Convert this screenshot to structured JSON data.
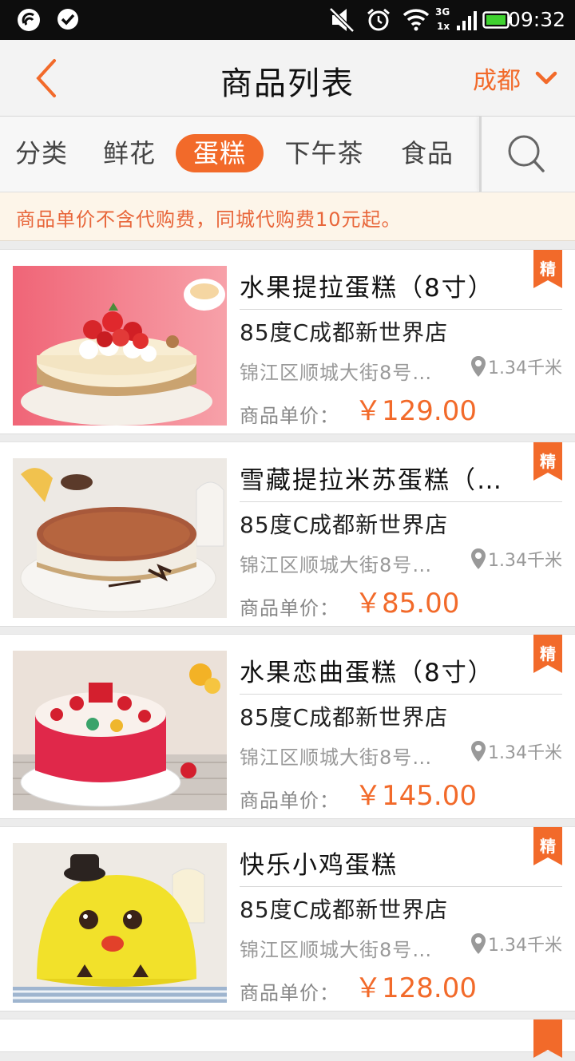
{
  "status_bar": {
    "time": "09:32",
    "network_label": "3G",
    "signal_sub_label": "1x",
    "icons": [
      "wechat-icon",
      "check-circle-icon",
      "mute-icon",
      "alarm-icon",
      "wifi-icon",
      "cell-signal-icon",
      "battery-icon"
    ],
    "battery_color": "#3fd12f"
  },
  "header": {
    "title": "商品列表",
    "city": "成都",
    "accent_color": "#f26a2a"
  },
  "tabs": [
    {
      "label": "分类",
      "active": false
    },
    {
      "label": "鲜花",
      "active": false
    },
    {
      "label": "蛋糕",
      "active": true
    },
    {
      "label": "下午茶",
      "active": false
    },
    {
      "label": "食品",
      "active": false
    }
  ],
  "notice": "商品单价不含代购费，同城代购费10元起。",
  "products": [
    {
      "name": "水果提拉蛋糕（8寸）",
      "store": "85度C成都新世界店",
      "address": "锦江区顺城大街8号…",
      "distance": "1.34千米",
      "price_label": "商品单价：",
      "price": "￥129.00",
      "badge": "精"
    },
    {
      "name": "雪藏提拉米苏蛋糕（…",
      "store": "85度C成都新世界店",
      "address": "锦江区顺城大街8号…",
      "distance": "1.34千米",
      "price_label": "商品单价：",
      "price": "￥85.00",
      "badge": "精"
    },
    {
      "name": "水果恋曲蛋糕（8寸）",
      "store": "85度C成都新世界店",
      "address": "锦江区顺城大街8号…",
      "distance": "1.34千米",
      "price_label": "商品单价：",
      "price": "￥145.00",
      "badge": "精"
    },
    {
      "name": "快乐小鸡蛋糕",
      "store": "85度C成都新世界店",
      "address": "锦江区顺城大街8号…",
      "distance": "1.34千米",
      "price_label": "商品单价：",
      "price": "￥128.00",
      "badge": "精"
    }
  ]
}
